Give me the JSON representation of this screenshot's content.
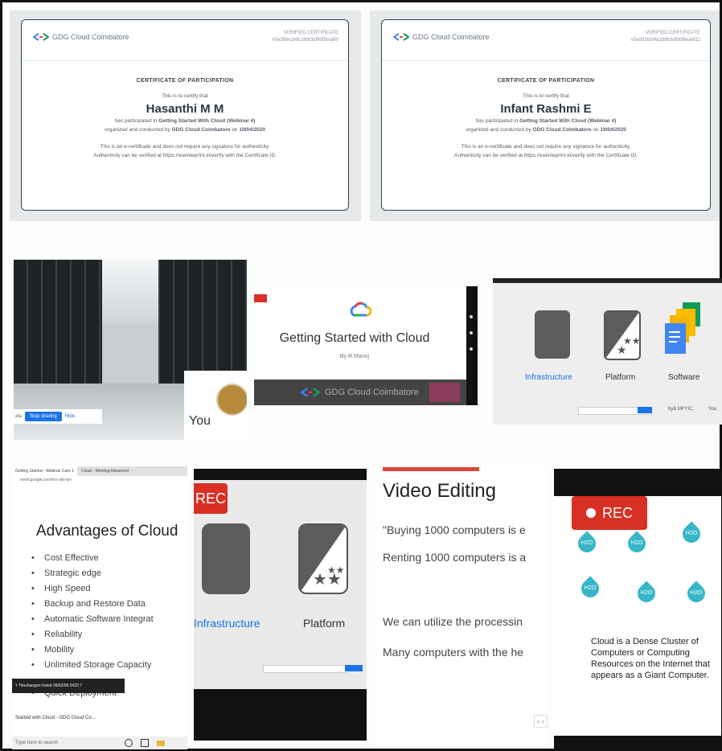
{
  "certificates": [
    {
      "org": "GDG Cloud Coimbatore",
      "verified_label": "VERIFIED CERTIFICATE",
      "cert_id": "#5e0f8ecd4fc3f6b3d9f0f5ea6f0",
      "heading": "CERTIFICATE OF PARTICIPATION",
      "certify": "This is to certify that",
      "name": "Hasanthi M M",
      "line1_prefix": "has participated in ",
      "event": "Getting Started With Cloud (Webinar 4)",
      "line2_prefix": "organized and conducted by ",
      "org_bold": "GDG Cloud Coimbatore",
      "line2_mid": " on ",
      "date": "19/04/2020",
      "note1": "This is an e-certificate and does not require any signature for authenticity.",
      "note2": "Authenticity can be verified at https://eventeprint.in/verify with the Certificate ID."
    },
    {
      "org": "GDG Cloud Coimbatore",
      "verified_label": "VERIFIED CERTIFICATE",
      "cert_id": "#5e833b5f4b2d9b3d5f0f6ea6f11",
      "heading": "CERTIFICATE OF PARTICIPATION",
      "certify": "This is to certify that",
      "name": "Infant Rashmi E",
      "line1_prefix": "has participated in ",
      "event": "Getting Started With Cloud (Webinar 4)",
      "line2_prefix": "organized and conducted by ",
      "org_bold": "GDG Cloud Coimbatore",
      "line2_mid": " on ",
      "date": "19/04/2020",
      "note1": "This is an e-certificate and does not require any signature for authenticity.",
      "note2": "Authenticity can be verified at https://eventeprint.in/verify with the Certificate ID."
    }
  ],
  "server_shot": {
    "you_label": "You",
    "btn_left": "ala",
    "btn_main": "Stop sharing",
    "btn_right": "Hide"
  },
  "getting_started": {
    "title": "Getting Started with Cloud",
    "by": "By R.Manoj",
    "brand": "GDG Cloud Coimbatore"
  },
  "iaas_slide": {
    "labels": [
      "Infrastructure",
      "Platform",
      "Software"
    ],
    "footer": "by& MFYIC",
    "footer_right": "You"
  },
  "advantages": {
    "tab1": "Getting Started - Webinar Cam 1",
    "tab2": "Cloud - Meeting Advanced",
    "url": "meet.google.com/vrx-okk-tyo",
    "title": "Advantages of Cloud",
    "items": [
      "Cost Effective",
      "Strategic edge",
      "High Speed",
      "Backup and Restore Data",
      "Automatic Software Integrat",
      "Reliability",
      "Mobility",
      "Unlimited Storage Capacity"
    ],
    "item_hidden": "Quick Deployment",
    "toast": "'r Timuhangen hoted 09/03/09 0432:7",
    "taskbar_title": "Started with Cloud - GDG Cloud Co...",
    "search": "Type here to search"
  },
  "platform_slide": {
    "rec": "REC",
    "labels": [
      "Infrastructure",
      "Platform"
    ]
  },
  "video_slide": {
    "title": "Video Editing",
    "lines": [
      "\"Buying 1000 computers is e",
      "Renting 1000 computers is a",
      "We can utilize the processin",
      "Many computers with the he"
    ],
    "pager": "‹ ›"
  },
  "h2o_slide": {
    "rec": "REC",
    "drop_label": "H2O",
    "text": "Cloud is a Dense Cluster of Computers or Computing Resources on the Internet that appears as a Giant Computer."
  }
}
